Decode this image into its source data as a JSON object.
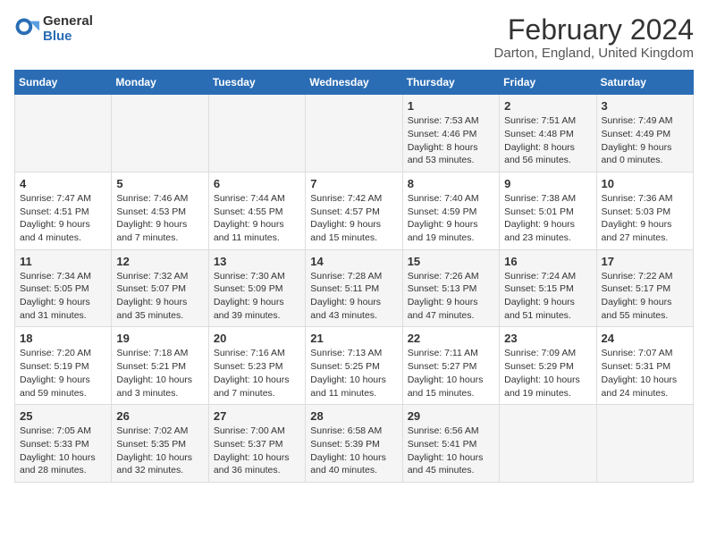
{
  "logo": {
    "general": "General",
    "blue": "Blue"
  },
  "title": "February 2024",
  "location": "Darton, England, United Kingdom",
  "days_of_week": [
    "Sunday",
    "Monday",
    "Tuesday",
    "Wednesday",
    "Thursday",
    "Friday",
    "Saturday"
  ],
  "weeks": [
    [
      {
        "day": "",
        "info": ""
      },
      {
        "day": "",
        "info": ""
      },
      {
        "day": "",
        "info": ""
      },
      {
        "day": "",
        "info": ""
      },
      {
        "day": "1",
        "info": "Sunrise: 7:53 AM\nSunset: 4:46 PM\nDaylight: 8 hours and 53 minutes."
      },
      {
        "day": "2",
        "info": "Sunrise: 7:51 AM\nSunset: 4:48 PM\nDaylight: 8 hours and 56 minutes."
      },
      {
        "day": "3",
        "info": "Sunrise: 7:49 AM\nSunset: 4:49 PM\nDaylight: 9 hours and 0 minutes."
      }
    ],
    [
      {
        "day": "4",
        "info": "Sunrise: 7:47 AM\nSunset: 4:51 PM\nDaylight: 9 hours and 4 minutes."
      },
      {
        "day": "5",
        "info": "Sunrise: 7:46 AM\nSunset: 4:53 PM\nDaylight: 9 hours and 7 minutes."
      },
      {
        "day": "6",
        "info": "Sunrise: 7:44 AM\nSunset: 4:55 PM\nDaylight: 9 hours and 11 minutes."
      },
      {
        "day": "7",
        "info": "Sunrise: 7:42 AM\nSunset: 4:57 PM\nDaylight: 9 hours and 15 minutes."
      },
      {
        "day": "8",
        "info": "Sunrise: 7:40 AM\nSunset: 4:59 PM\nDaylight: 9 hours and 19 minutes."
      },
      {
        "day": "9",
        "info": "Sunrise: 7:38 AM\nSunset: 5:01 PM\nDaylight: 9 hours and 23 minutes."
      },
      {
        "day": "10",
        "info": "Sunrise: 7:36 AM\nSunset: 5:03 PM\nDaylight: 9 hours and 27 minutes."
      }
    ],
    [
      {
        "day": "11",
        "info": "Sunrise: 7:34 AM\nSunset: 5:05 PM\nDaylight: 9 hours and 31 minutes."
      },
      {
        "day": "12",
        "info": "Sunrise: 7:32 AM\nSunset: 5:07 PM\nDaylight: 9 hours and 35 minutes."
      },
      {
        "day": "13",
        "info": "Sunrise: 7:30 AM\nSunset: 5:09 PM\nDaylight: 9 hours and 39 minutes."
      },
      {
        "day": "14",
        "info": "Sunrise: 7:28 AM\nSunset: 5:11 PM\nDaylight: 9 hours and 43 minutes."
      },
      {
        "day": "15",
        "info": "Sunrise: 7:26 AM\nSunset: 5:13 PM\nDaylight: 9 hours and 47 minutes."
      },
      {
        "day": "16",
        "info": "Sunrise: 7:24 AM\nSunset: 5:15 PM\nDaylight: 9 hours and 51 minutes."
      },
      {
        "day": "17",
        "info": "Sunrise: 7:22 AM\nSunset: 5:17 PM\nDaylight: 9 hours and 55 minutes."
      }
    ],
    [
      {
        "day": "18",
        "info": "Sunrise: 7:20 AM\nSunset: 5:19 PM\nDaylight: 9 hours and 59 minutes."
      },
      {
        "day": "19",
        "info": "Sunrise: 7:18 AM\nSunset: 5:21 PM\nDaylight: 10 hours and 3 minutes."
      },
      {
        "day": "20",
        "info": "Sunrise: 7:16 AM\nSunset: 5:23 PM\nDaylight: 10 hours and 7 minutes."
      },
      {
        "day": "21",
        "info": "Sunrise: 7:13 AM\nSunset: 5:25 PM\nDaylight: 10 hours and 11 minutes."
      },
      {
        "day": "22",
        "info": "Sunrise: 7:11 AM\nSunset: 5:27 PM\nDaylight: 10 hours and 15 minutes."
      },
      {
        "day": "23",
        "info": "Sunrise: 7:09 AM\nSunset: 5:29 PM\nDaylight: 10 hours and 19 minutes."
      },
      {
        "day": "24",
        "info": "Sunrise: 7:07 AM\nSunset: 5:31 PM\nDaylight: 10 hours and 24 minutes."
      }
    ],
    [
      {
        "day": "25",
        "info": "Sunrise: 7:05 AM\nSunset: 5:33 PM\nDaylight: 10 hours and 28 minutes."
      },
      {
        "day": "26",
        "info": "Sunrise: 7:02 AM\nSunset: 5:35 PM\nDaylight: 10 hours and 32 minutes."
      },
      {
        "day": "27",
        "info": "Sunrise: 7:00 AM\nSunset: 5:37 PM\nDaylight: 10 hours and 36 minutes."
      },
      {
        "day": "28",
        "info": "Sunrise: 6:58 AM\nSunset: 5:39 PM\nDaylight: 10 hours and 40 minutes."
      },
      {
        "day": "29",
        "info": "Sunrise: 6:56 AM\nSunset: 5:41 PM\nDaylight: 10 hours and 45 minutes."
      },
      {
        "day": "",
        "info": ""
      },
      {
        "day": "",
        "info": ""
      }
    ]
  ]
}
